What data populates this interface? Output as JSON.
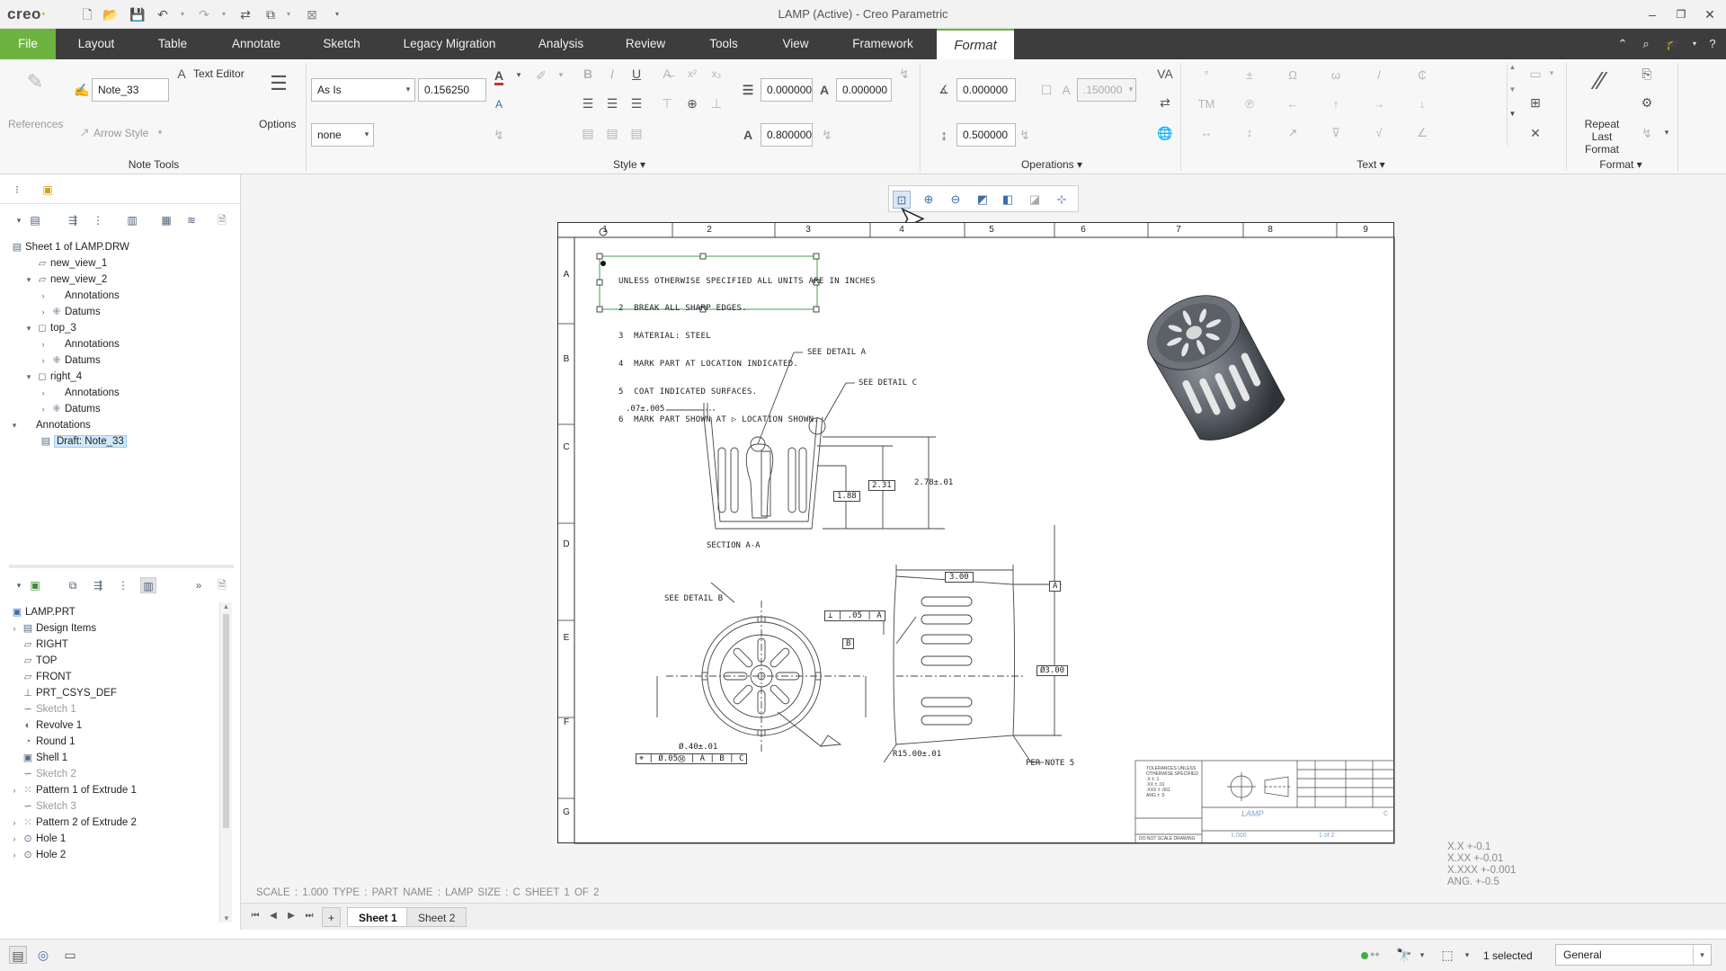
{
  "app": {
    "logo": "creo",
    "window_title": "LAMP (Active) - Creo Parametric"
  },
  "menu": {
    "tabs": [
      "File",
      "Layout",
      "Table",
      "Annotate",
      "Sketch",
      "Legacy Migration",
      "Analysis",
      "Review",
      "Tools",
      "View",
      "Framework",
      "Format"
    ],
    "active_tab": "Format"
  },
  "ribbon": {
    "note_tools": {
      "references_label": "References",
      "note_name": "Note_33",
      "text_editor_label": "Text Editor",
      "arrow_style_label": "Arrow Style",
      "group_label": "Note Tools"
    },
    "options": {
      "label": "Options"
    },
    "style": {
      "style_select": "As Is",
      "text_height": "0.156250",
      "line_style": "none",
      "line_spacing": "0.000000",
      "char_spacing": "0.000000",
      "width_factor": "0.800000",
      "group_label": "Style"
    },
    "operations": {
      "angle": "0.000000",
      "slant_disabled": ".150000",
      "spacing": "0.500000",
      "group_label": "Operations"
    },
    "text": {
      "symbols": [
        "°",
        "±",
        "Ω",
        "ω",
        "/",
        "₵",
        "TM",
        "℗",
        "←",
        "↑",
        "→",
        "↓",
        "↔",
        "↕",
        "↗",
        "⊽",
        "√",
        "∠"
      ],
      "group_label": "Text"
    },
    "format": {
      "repeat_last_label": "Repeat Last Format",
      "group_label": "Format"
    }
  },
  "drawing_tree": {
    "root": "Sheet 1 of LAMP.DRW",
    "items": [
      {
        "label": "new_view_1",
        "level": 1,
        "expand": ""
      },
      {
        "label": "new_view_2",
        "level": 1,
        "expand": "▾"
      },
      {
        "label": "Annotations",
        "level": 2,
        "expand": "›"
      },
      {
        "label": "Datums",
        "level": 2,
        "expand": "›"
      },
      {
        "label": "top_3",
        "level": 1,
        "expand": "▾"
      },
      {
        "label": "Annotations",
        "level": 2,
        "expand": "›"
      },
      {
        "label": "Datums",
        "level": 2,
        "expand": "›"
      },
      {
        "label": "right_4",
        "level": 1,
        "expand": "▾"
      },
      {
        "label": "Annotations",
        "level": 2,
        "expand": "›"
      },
      {
        "label": "Datums",
        "level": 2,
        "expand": "›"
      },
      {
        "label": "Annotations",
        "level": 0,
        "expand": "▾"
      }
    ],
    "selected": "Draft: Note_33"
  },
  "model_tree": {
    "root": "LAMP.PRT",
    "items": [
      {
        "label": "Design Items",
        "dim": false,
        "expand": "›"
      },
      {
        "label": "RIGHT",
        "dim": false,
        "expand": ""
      },
      {
        "label": "TOP",
        "dim": false,
        "expand": ""
      },
      {
        "label": "FRONT",
        "dim": false,
        "expand": ""
      },
      {
        "label": "PRT_CSYS_DEF",
        "dim": false,
        "expand": ""
      },
      {
        "label": "Sketch 1",
        "dim": true,
        "expand": ""
      },
      {
        "label": "Revolve 1",
        "dim": false,
        "expand": ""
      },
      {
        "label": "Round 1",
        "dim": false,
        "expand": ""
      },
      {
        "label": "Shell 1",
        "dim": false,
        "expand": ""
      },
      {
        "label": "Sketch 2",
        "dim": true,
        "expand": ""
      },
      {
        "label": "Pattern 1 of Extrude 1",
        "dim": false,
        "expand": "›"
      },
      {
        "label": "Sketch 3",
        "dim": true,
        "expand": ""
      },
      {
        "label": "Pattern 2 of Extrude 2",
        "dim": false,
        "expand": "›"
      },
      {
        "label": "Hole 1",
        "dim": false,
        "expand": "›"
      },
      {
        "label": "Hole 2",
        "dim": false,
        "expand": "›"
      }
    ]
  },
  "drawing": {
    "columns": [
      "1",
      "2",
      "3",
      "4",
      "5",
      "6",
      "7",
      "8",
      "9"
    ],
    "rows": [
      "A",
      "B",
      "C",
      "D",
      "E",
      "F",
      "G"
    ],
    "note_lines": [
      "UNLESS OTHERWISE SPECIFIED ALL UNITS ARE IN INCHES",
      "2  BREAK ALL SHARP EDGES.",
      "3  MATERIAL: STEEL",
      "4  MARK PART AT LOCATION INDICATED.",
      "5  COAT INDICATED SURFACES.",
      "6  MARK PART SHOWN AT ▷ LOCATION SHOWN."
    ],
    "labels": {
      "see_detail_a": "SEE DETAIL A",
      "see_detail_c": "SEE DETAIL C",
      "see_detail_b": "SEE DETAIL B",
      "section": "SECTION A-A",
      "per_note": "PER NOTE 5"
    },
    "dims": {
      "d1": ".07±.005",
      "d2": "1.88",
      "d3": "2.31",
      "d4": "2.78±.01",
      "d5": "3.00",
      "d6": "Ø3.00",
      "d7": "Ø.40±.01",
      "d8": "R15.00±.01",
      "d9": ".05",
      "datum_a": "A",
      "datum_b": "B"
    },
    "title_block": {
      "part_name": "LAMP",
      "scale": "1.000",
      "sheet": "1 of 2",
      "letter": "C",
      "footer": "DO NOT SCALE DRAWING"
    }
  },
  "status_line": "SCALE : 1.000    TYPE : PART    NAME : LAMP    SIZE : C    SHEET 1  OF 2",
  "tolerance": [
    "X.X  +-0.1",
    "X.XX  +-0.01",
    "X.XXX  +-0.001",
    "ANG.  +-0.5"
  ],
  "sheets": [
    "Sheet 1",
    "Sheet 2"
  ],
  "active_sheet": "Sheet 1",
  "statusbar": {
    "selected": "1 selected",
    "filter": "General"
  },
  "colors": {
    "accent_green": "#6db33f",
    "menu_dark": "#3d3d3d",
    "selection_green": "#41a04a"
  }
}
